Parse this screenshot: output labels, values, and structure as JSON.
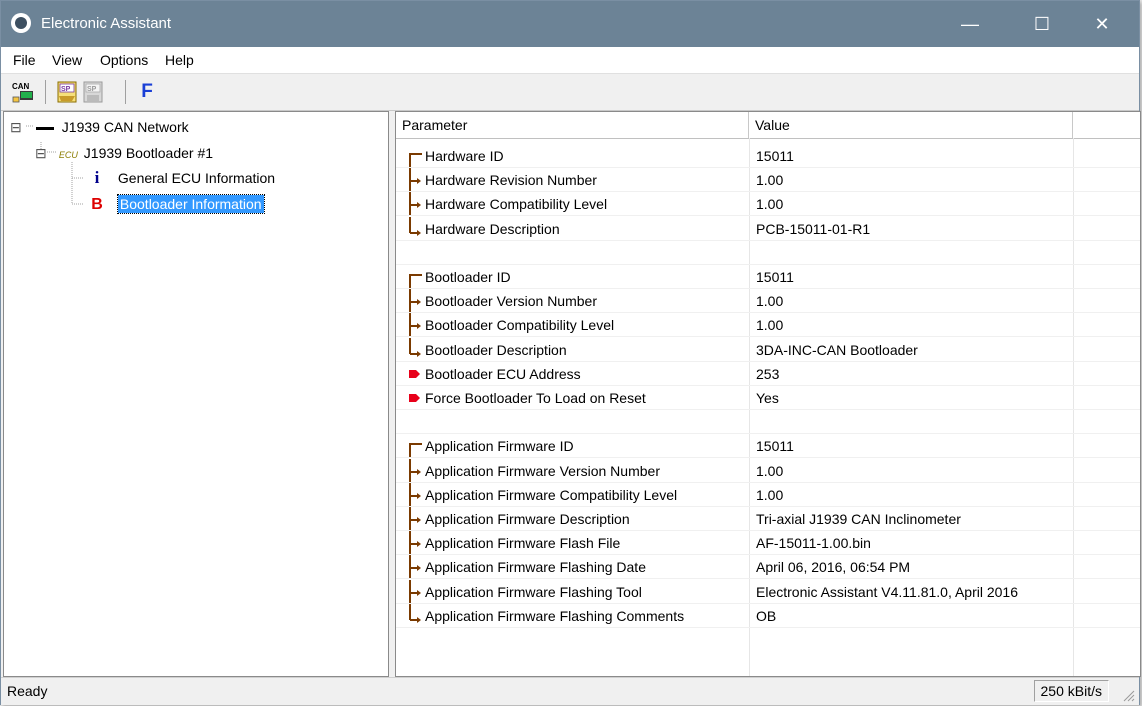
{
  "window": {
    "title": "Electronic Assistant",
    "minimize_glyph": "—",
    "maximize_glyph": "☐",
    "close_glyph": "✕"
  },
  "menu": [
    {
      "label": "File"
    },
    {
      "label": "View"
    },
    {
      "label": "Options"
    },
    {
      "label": "Help"
    }
  ],
  "toolbar": [
    {
      "name": "can-network-icon",
      "text": "CAN"
    },
    {
      "name": "save-sp-icon",
      "text": "SP"
    },
    {
      "name": "load-sp-icon",
      "text": "SP"
    },
    {
      "name": "flash-icon",
      "text": "F"
    }
  ],
  "tree": {
    "root": {
      "expander": "⊟",
      "label": "J1939 CAN Network"
    },
    "ecu": {
      "expander": "⊟",
      "tag": "ECU",
      "label": "J1939 Bootloader #1"
    },
    "children": [
      {
        "glyph": "i",
        "label": "General ECU Information",
        "selected": false
      },
      {
        "glyph": "B",
        "label": "Bootloader Information",
        "selected": true
      }
    ]
  },
  "table": {
    "headers": [
      "Parameter",
      "Value"
    ],
    "rows": [
      {
        "marker": "first",
        "parameter": "Hardware ID",
        "value": "15011"
      },
      {
        "marker": "mid",
        "parameter": "Hardware Revision Number",
        "value": "1.00"
      },
      {
        "marker": "mid",
        "parameter": "Hardware Compatibility Level",
        "value": "1.00"
      },
      {
        "marker": "last",
        "parameter": "Hardware Description",
        "value": "PCB-15011-01-R1"
      },
      {
        "marker": "blank",
        "parameter": "",
        "value": ""
      },
      {
        "marker": "first",
        "parameter": "Bootloader ID",
        "value": "15011"
      },
      {
        "marker": "mid",
        "parameter": "Bootloader Version Number",
        "value": "1.00"
      },
      {
        "marker": "mid",
        "parameter": "Bootloader Compatibility Level",
        "value": "1.00"
      },
      {
        "marker": "last",
        "parameter": "Bootloader Description",
        "value": "3DA-INC-CAN Bootloader"
      },
      {
        "marker": "editable",
        "parameter": "Bootloader ECU Address",
        "value": "253"
      },
      {
        "marker": "editable",
        "parameter": "Force Bootloader To Load on Reset",
        "value": "Yes"
      },
      {
        "marker": "blank",
        "parameter": "",
        "value": ""
      },
      {
        "marker": "first",
        "parameter": "Application Firmware ID",
        "value": "15011"
      },
      {
        "marker": "mid",
        "parameter": "Application Firmware Version Number",
        "value": "1.00"
      },
      {
        "marker": "mid",
        "parameter": "Application Firmware Compatibility Level",
        "value": "1.00"
      },
      {
        "marker": "mid",
        "parameter": "Application Firmware Description",
        "value": "Tri-axial J1939 CAN Inclinometer"
      },
      {
        "marker": "mid",
        "parameter": "Application Firmware Flash File",
        "value": "AF-15011-1.00.bin"
      },
      {
        "marker": "mid",
        "parameter": "Application Firmware Flashing Date",
        "value": "April 06, 2016, 06:54 PM"
      },
      {
        "marker": "mid",
        "parameter": "Application Firmware Flashing Tool",
        "value": "Electronic Assistant V4.11.81.0, April 2016"
      },
      {
        "marker": "last",
        "parameter": "Application Firmware Flashing Comments",
        "value": "OB"
      }
    ]
  },
  "status": {
    "left": "Ready",
    "bitrate": "250 kBit/s"
  },
  "colors": {
    "titlebar": "#6c8396",
    "selection": "#3399ff",
    "tree_marker": "#7a3a00",
    "edit_marker": "#e8001a",
    "info_icon": "#00008b",
    "boot_icon": "#dd0000"
  }
}
